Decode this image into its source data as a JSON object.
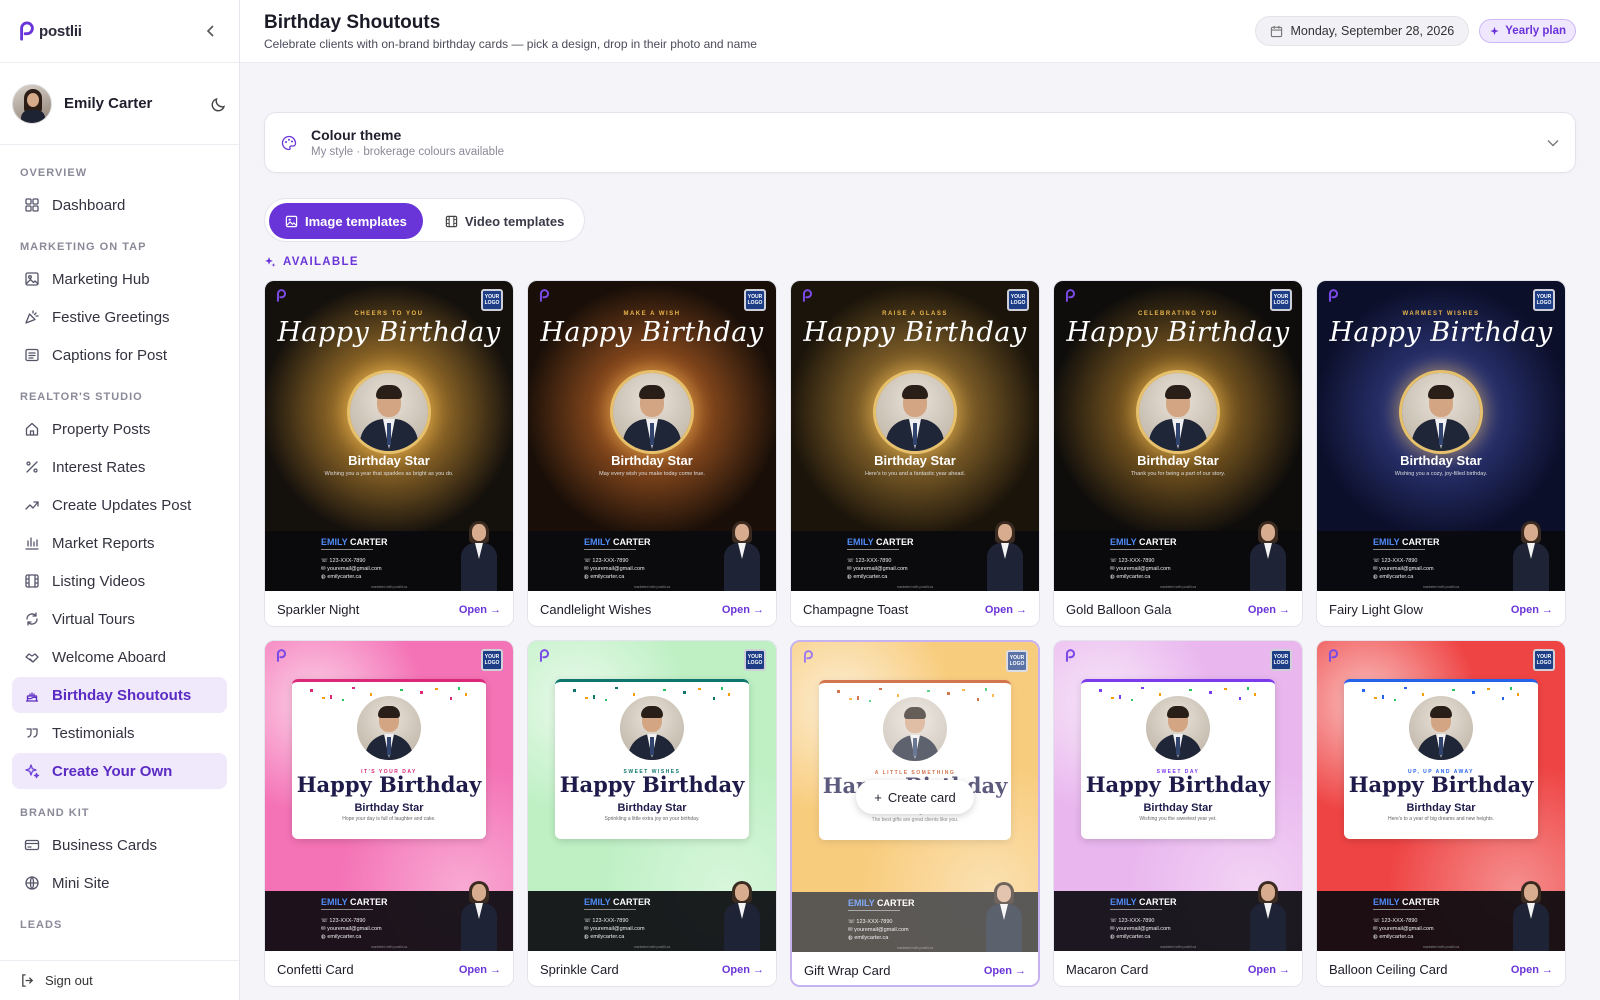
{
  "app": {
    "name": "postlii"
  },
  "user": {
    "name": "Emily Carter"
  },
  "nav": {
    "sections": [
      {
        "label": "OVERVIEW",
        "items": [
          {
            "label": "Dashboard",
            "icon": "grid-icon"
          }
        ]
      },
      {
        "label": "MARKETING ON TAP",
        "items": [
          {
            "label": "Marketing Hub",
            "icon": "image-icon"
          },
          {
            "label": "Festive Greetings",
            "icon": "party-icon"
          },
          {
            "label": "Captions for Post",
            "icon": "caption-icon"
          }
        ]
      },
      {
        "label": "REALTOR'S STUDIO",
        "items": [
          {
            "label": "Property Posts",
            "icon": "home-icon"
          },
          {
            "label": "Interest Rates",
            "icon": "percent-icon"
          },
          {
            "label": "Create Updates Post",
            "icon": "trend-icon"
          },
          {
            "label": "Market Reports",
            "icon": "bar-chart-icon"
          },
          {
            "label": "Listing Videos",
            "icon": "film-icon"
          },
          {
            "label": "Virtual Tours",
            "icon": "rotate-icon"
          },
          {
            "label": "Welcome Aboard",
            "icon": "handshake-icon"
          },
          {
            "label": "Birthday Shoutouts",
            "icon": "cake-icon",
            "active": true
          },
          {
            "label": "Testimonials",
            "icon": "quote-icon"
          },
          {
            "label": "Create Your Own",
            "icon": "sparkles-icon",
            "accent": true
          }
        ]
      },
      {
        "label": "BRAND KIT",
        "items": [
          {
            "label": "Business Cards",
            "icon": "card-icon"
          },
          {
            "label": "Mini Site",
            "icon": "globe-icon"
          }
        ]
      },
      {
        "label": "LEADS",
        "items": []
      }
    ],
    "signout": "Sign out"
  },
  "header": {
    "title": "Birthday Shoutouts",
    "subtitle": "Celebrate clients with on-brand birthday cards — pick a design, drop in their photo and name",
    "date": "Monday, September 28, 2026",
    "plan": "Yearly plan"
  },
  "theme": {
    "title": "Colour theme",
    "subtitle": "My style · brokerage colours available"
  },
  "tabs": {
    "image": "Image templates",
    "video": "Video templates"
  },
  "available_label": "AVAILABLE",
  "card_common": {
    "open": "Open →",
    "logo": "YOUR LOGO",
    "headline": "Happy Birthday",
    "star": "Birthday Star",
    "agent_first": "EMILY",
    "agent_last": "CARTER",
    "phone": "123-XXX-7890",
    "email": "youremail@gmail.com",
    "site": "emilycarter.ca",
    "footer": "marketed with postlii.ca",
    "create": "Create card"
  },
  "cards": [
    {
      "name": "Sparkler Night",
      "kicker": "CHEERS TO YOU",
      "wish": "Wishing you a year that sparkles as bright as you do.",
      "style": "dark",
      "bg": "#14100c",
      "glow": "#e9a73a"
    },
    {
      "name": "Candlelight Wishes",
      "kicker": "MAKE A WISH",
      "wish": "May every wish you make today come true.",
      "style": "dark",
      "bg": "#1a0f08",
      "glow": "#d9742c"
    },
    {
      "name": "Champagne Toast",
      "kicker": "RAISE A GLASS",
      "wish": "Here's to you and a fantastic year ahead.",
      "style": "dark",
      "bg": "#1b140a",
      "glow": "#c9963e"
    },
    {
      "name": "Gold Balloon Gala",
      "kicker": "CELEBRATING YOU",
      "wish": "Thank you for being a part of our story.",
      "style": "dark",
      "bg": "#0f0d0b",
      "glow": "#c28a2e"
    },
    {
      "name": "Fairy Light Glow",
      "kicker": "WARMEST WISHES",
      "wish": "Wishing you a cozy, joy-filled birthday.",
      "style": "dark",
      "bg": "#0c0f2a",
      "glow": "#3d4aa0"
    },
    {
      "name": "Confetti Card",
      "kicker": "IT'S YOUR DAY",
      "wish": "Hope your day is full of laughter and cake.",
      "style": "light",
      "bg": "#f472b6",
      "accent": "#db2777"
    },
    {
      "name": "Sprinkle Card",
      "kicker": "SWEET WISHES",
      "wish": "Sprinkling a little extra joy on your birthday.",
      "style": "light",
      "bg": "#bef0c4",
      "accent": "#0f766e"
    },
    {
      "name": "Gift Wrap Card",
      "kicker": "A LITTLE SOMETHING",
      "wish": "The best gifts are great clients like you.",
      "style": "light",
      "bg": "#f6b94c",
      "accent": "#c2410c",
      "hover": true
    },
    {
      "name": "Macaron Card",
      "kicker": "SWEET DAY",
      "wish": "Wishing you the sweetest year yet.",
      "style": "light",
      "bg": "#e9b6ee",
      "accent": "#7c3aed"
    },
    {
      "name": "Balloon Ceiling Card",
      "kicker": "UP, UP AND AWAY",
      "wish": "Here's to a year of big dreams and new heights.",
      "style": "light",
      "bg": "#ef4444",
      "accent": "#2563eb"
    }
  ]
}
